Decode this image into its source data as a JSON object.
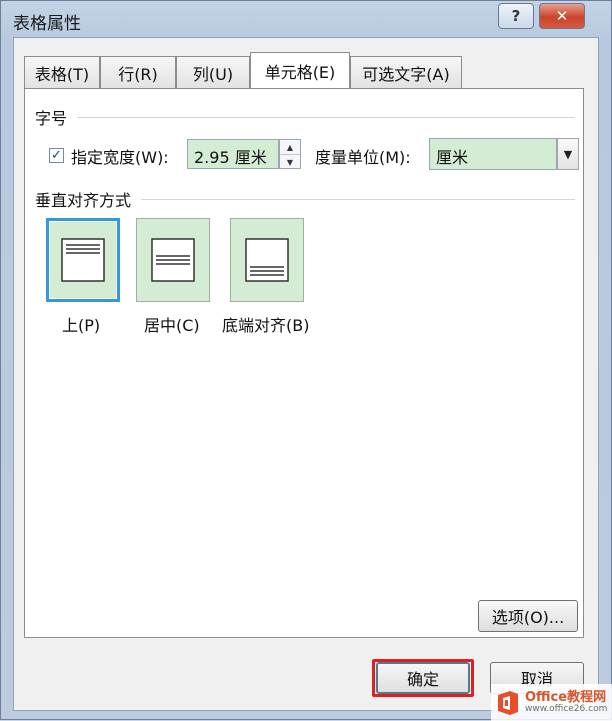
{
  "window": {
    "title": "表格属性",
    "help_label": "?",
    "close_label": "✕"
  },
  "tabs": [
    {
      "label": "表格(T)",
      "active": false
    },
    {
      "label": "行(R)",
      "active": false
    },
    {
      "label": "列(U)",
      "active": false
    },
    {
      "label": "单元格(E)",
      "active": true
    },
    {
      "label": "可选文字(A)",
      "active": false
    }
  ],
  "size_group": {
    "title": "字号",
    "specify_width_label": "指定宽度(W):",
    "specify_width_checked": true,
    "width_value": "2.95 厘米",
    "unit_label": "度量单位(M):",
    "unit_value": "厘米"
  },
  "valign_group": {
    "title": "垂直对齐方式",
    "options": [
      {
        "label": "上(P)",
        "icon": "align-top-icon",
        "selected": true
      },
      {
        "label": "居中(C)",
        "icon": "align-center-icon",
        "selected": false
      },
      {
        "label": "底端对齐(B)",
        "icon": "align-bottom-icon",
        "selected": false
      }
    ]
  },
  "buttons": {
    "options": "选项(O)...",
    "ok": "确定",
    "cancel": "取消"
  },
  "watermark": {
    "brand": "Office教程网",
    "url": "www.office26.com"
  },
  "colors": {
    "field_bg": "#d4ecd4",
    "selected_border": "#3399dd",
    "highlight": "#e02020"
  }
}
